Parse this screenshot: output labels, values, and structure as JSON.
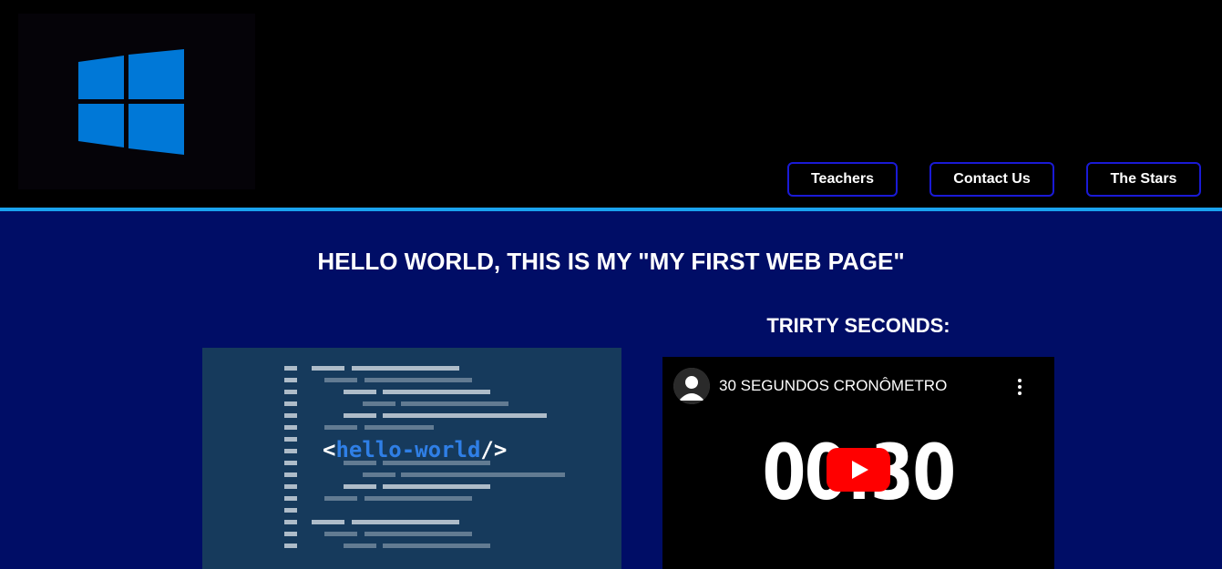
{
  "header": {
    "logo": "windows-logo",
    "nav": [
      {
        "label": "Teachers"
      },
      {
        "label": "Contact Us"
      },
      {
        "label": "The Stars"
      }
    ]
  },
  "colors": {
    "header_bg": "#000000",
    "divider": "#1aa3f0",
    "main_bg": "#000d66",
    "nav_border": "#1a1ad6",
    "logo_blue": "#0078d7"
  },
  "main": {
    "title": "HELLO WORLD, THIS IS MY \"MY FIRST WEB PAGE\"",
    "video_heading": "TRIRTY SECONDS:",
    "image": {
      "code_text_open": "<",
      "code_text_word": "hello-world",
      "code_text_close": "/>"
    },
    "video": {
      "title": "30 SEGUNDOS CRONÔMETRO",
      "timer_text": "00:30"
    }
  }
}
